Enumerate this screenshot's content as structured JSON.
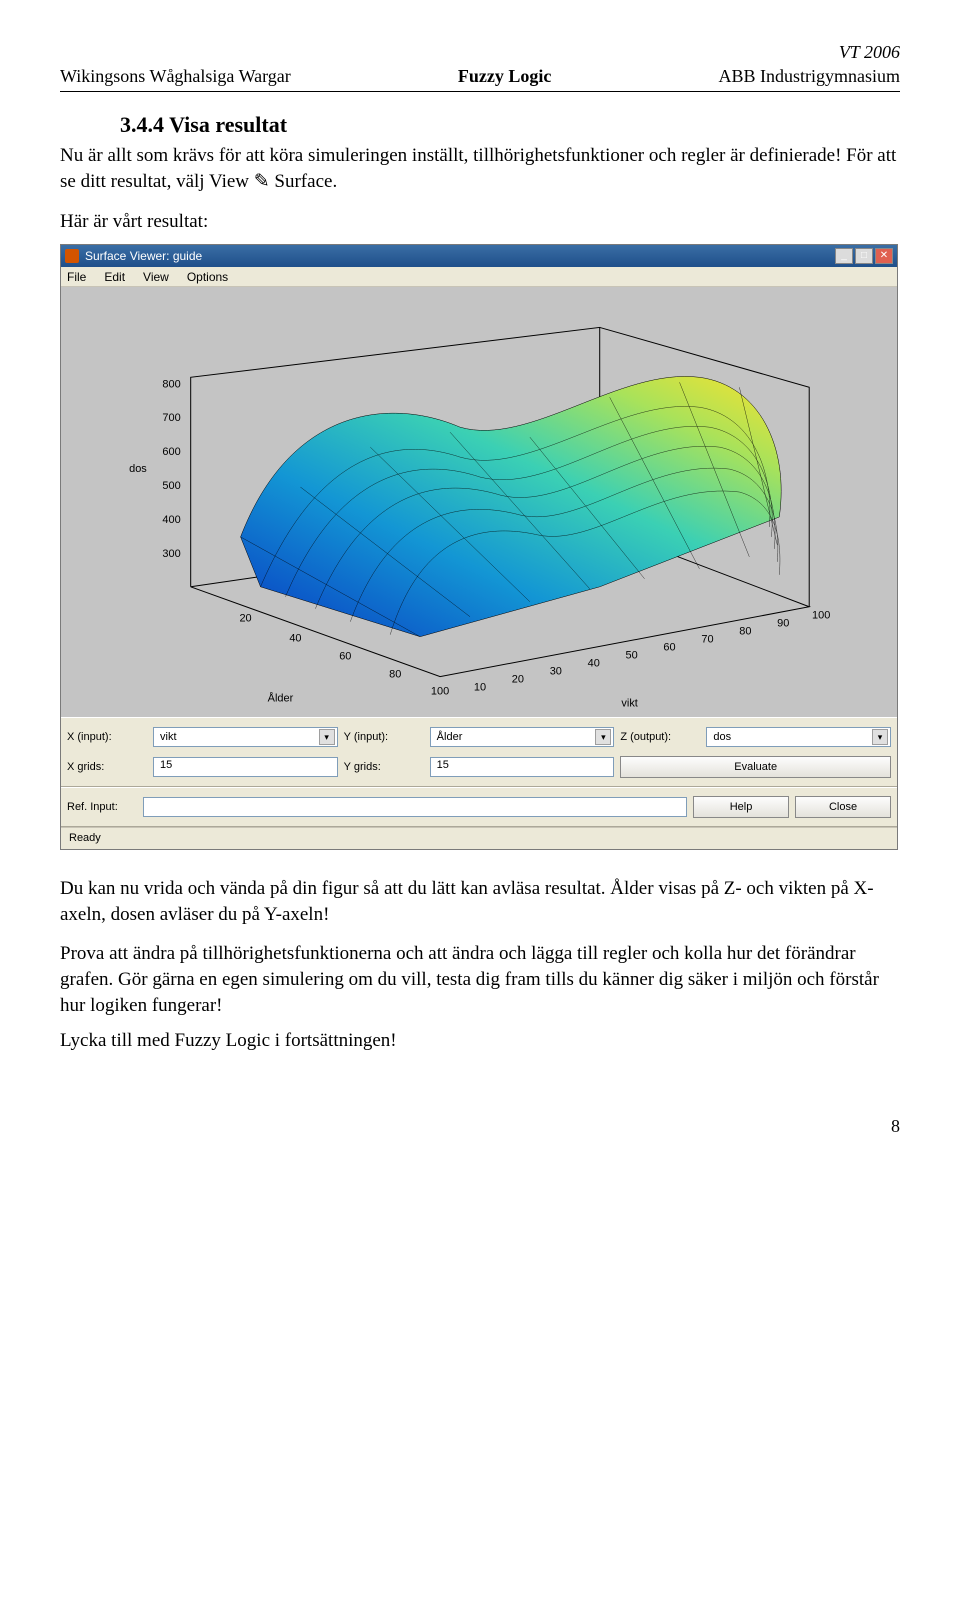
{
  "header": {
    "right_top": "VT 2006",
    "left": "Wikingsons Wåghalsiga Wargar",
    "center": "Fuzzy Logic",
    "right": "ABB Industrigymnasium"
  },
  "section": {
    "number_title": "3.4.4  Visa resultat",
    "p1": "Nu är allt som krävs för att köra simuleringen inställt, tillhörighetsfunktioner och regler är definierade! För att se ditt resultat, välj View ✎ Surface.",
    "p2": "Här är vårt resultat:",
    "p3": "Du kan nu vrida och vända på din figur så att du lätt kan avläsa resultat. Ålder visas på Z- och vikten på X-axeln, dosen avläser du på Y-axeln!",
    "p4": "Prova att ändra på tillhörighetsfunktionerna och att ändra och lägga till regler och kolla hur det förändrar grafen. Gör gärna en egen simulering om du vill, testa dig fram tills du känner dig säker i miljön och förstår hur logiken fungerar!",
    "p5": "Lycka till med Fuzzy Logic i fortsättningen!"
  },
  "app": {
    "title": "Surface Viewer: guide",
    "menu": {
      "file": "File",
      "edit": "Edit",
      "view": "View",
      "options": "Options"
    },
    "axes": {
      "z_label": "dos",
      "x_label": "Ålder",
      "y_label": "vikt",
      "x_ticks": [
        "20",
        "40",
        "60",
        "80",
        "100"
      ],
      "y_ticks": [
        "10",
        "20",
        "30",
        "40",
        "50",
        "60",
        "70",
        "80",
        "90",
        "100"
      ],
      "z_ticks": [
        "300",
        "400",
        "500",
        "600",
        "700",
        "800"
      ]
    },
    "controls": {
      "x_input_label": "X (input):",
      "x_input_value": "vikt",
      "y_input_label": "Y (input):",
      "y_input_value": "Ålder",
      "z_output_label": "Z (output):",
      "z_output_value": "dos",
      "x_grids_label": "X grids:",
      "x_grids_value": "15",
      "y_grids_label": "Y grids:",
      "y_grids_value": "15",
      "evaluate": "Evaluate",
      "ref_input_label": "Ref. Input:",
      "ref_input_value": "",
      "help": "Help",
      "close": "Close"
    },
    "status": "Ready"
  },
  "page_number": "8"
}
